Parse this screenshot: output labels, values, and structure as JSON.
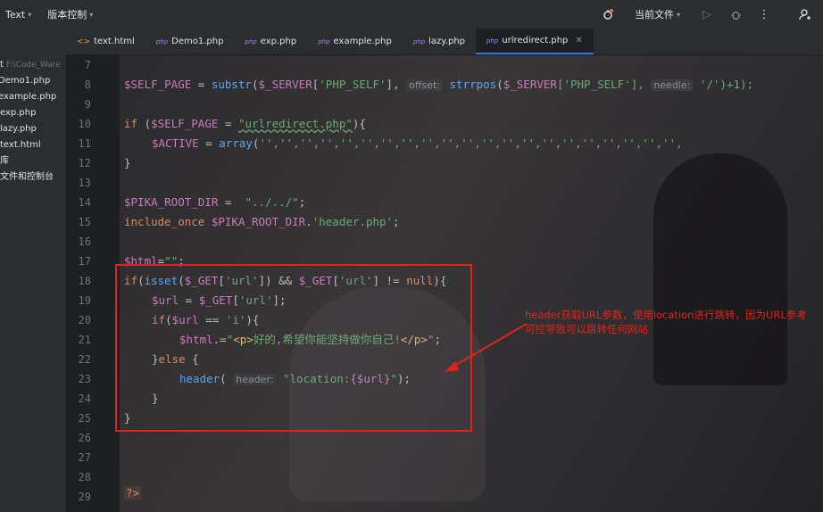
{
  "topbar": {
    "project": "Text",
    "vcs": "版本控制",
    "run_config": "当前文件"
  },
  "sidebar": {
    "items": [
      {
        "label": "t",
        "path": "F:\\Code_Ware"
      },
      {
        "label": "Demo1.php"
      },
      {
        "label": "example.php"
      },
      {
        "label": "exp.php"
      },
      {
        "label": "lazy.php"
      },
      {
        "label": "text.html"
      },
      {
        "label": "库"
      },
      {
        "label": "文件和控制台"
      }
    ]
  },
  "tabs": [
    {
      "label": "text.html",
      "type": "html"
    },
    {
      "label": "Demo1.php",
      "type": "php"
    },
    {
      "label": "exp.php",
      "type": "php"
    },
    {
      "label": "example.php",
      "type": "php"
    },
    {
      "label": "lazy.php",
      "type": "php"
    },
    {
      "label": "urlredirect.php",
      "type": "php",
      "active": true
    }
  ],
  "badge_php": "php",
  "badge_html": "<>",
  "line_numbers": [
    "7",
    "8",
    "9",
    "10",
    "11",
    "12",
    "13",
    "14",
    "15",
    "16",
    "17",
    "18",
    "19",
    "20",
    "21",
    "22",
    "23",
    "24",
    "25",
    "26",
    "27",
    "28",
    "29"
  ],
  "code": {
    "l8a": "$SELF_PAGE",
    "l8b": " = ",
    "l8c": "substr",
    "l8d": "(",
    "l8e": "$_SERVER",
    "l8f": "[",
    "l8g": "'PHP_SELF'",
    "l8h": "],",
    "l8i": "offset:",
    "l8j": "strrpos",
    "l8k": "(",
    "l8l": "$_SERVER",
    "l8m": "['PHP_SELF'],",
    "l8n": "needle:",
    "l8o": "'/')+1);",
    "l10a": "if",
    "l10b": " (",
    "l10c": "$SELF_PAGE",
    "l10d": " = ",
    "l10e": "\"urlredirect.php\"",
    "l10f": "){",
    "l11a": "$ACTIVE",
    "l11b": " = ",
    "l11c": "array",
    "l11d": "(",
    "l11e": "'','','','','','','','','','','','','','','','','','','','','',",
    "l12": "}",
    "l14a": "$PIKA_ROOT_DIR",
    "l14b": " =  ",
    "l14c": "\"../../\"",
    "l14d": ";",
    "l15a": "include_once",
    "l15b": " ",
    "l15c": "$PIKA_ROOT_DIR",
    "l15d": ".",
    "l15e": "'header.php'",
    "l15f": ";",
    "l17a": "$html",
    "l17b": "=",
    "l17c": "\"\"",
    "l17d": ";",
    "l18a": "if",
    "l18b": "(",
    "l18c": "isset",
    "l18d": "(",
    "l18e": "$_GET",
    "l18f": "[",
    "l18g": "'url'",
    "l18h": "]) && ",
    "l18i": "$_GET",
    "l18j": "[",
    "l18k": "'url'",
    "l18l": "] != ",
    "l18m": "null",
    "l18n": "){",
    "l19a": "$url",
    "l19b": " = ",
    "l19c": "$_GET",
    "l19d": "[",
    "l19e": "'url'",
    "l19f": "];",
    "l20a": "if",
    "l20b": "(",
    "l20c": "$url",
    "l20d": " == ",
    "l20e": "'i'",
    "l20f": "){",
    "l21a": "$html",
    "l21b": ".=",
    "l21c": "\"",
    "l21d": "<p>",
    "l21e": "好的,希望你能坚持做你自己!",
    "l21f": "</p>",
    "l21g": "\"",
    "l21h": ";",
    "l22a": "}",
    "l22b": "else",
    "l22c": " {",
    "l23a": "header",
    "l23b": "( ",
    "l23c": "header:",
    "l23d": " \"location:",
    "l23e": "{$url}",
    "l23f": "\"",
    "l23g": ");",
    "l24": "}",
    "l25": "}",
    "l29": "?>"
  },
  "annotation": "header获取URL参数，使用location进行跳转，因为URL参考可控导致可以跳转任何网站",
  "colors": {
    "accent_tab": "#3574f0",
    "annotation_red": "#e2231a"
  }
}
